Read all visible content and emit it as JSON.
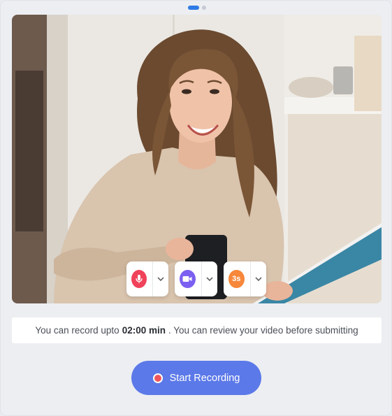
{
  "pager": {
    "total": 2,
    "active": 1
  },
  "video": {
    "description_icon": "webcam-preview"
  },
  "controls": {
    "mic": {
      "icon": "microphone-icon",
      "color": "#f0425a"
    },
    "camera": {
      "icon": "video-camera-icon",
      "color": "#7b5ff0"
    },
    "timer": {
      "icon": "countdown-timer-icon",
      "label": "3s",
      "color": "#f7873a"
    }
  },
  "info": {
    "prefix": "You can record upto",
    "duration": "02:00 min",
    "suffix": ". You can review your video before submitting"
  },
  "record_button": {
    "label": "Start Recording",
    "color": "#5b79e8",
    "dot_color": "#f2545b"
  }
}
